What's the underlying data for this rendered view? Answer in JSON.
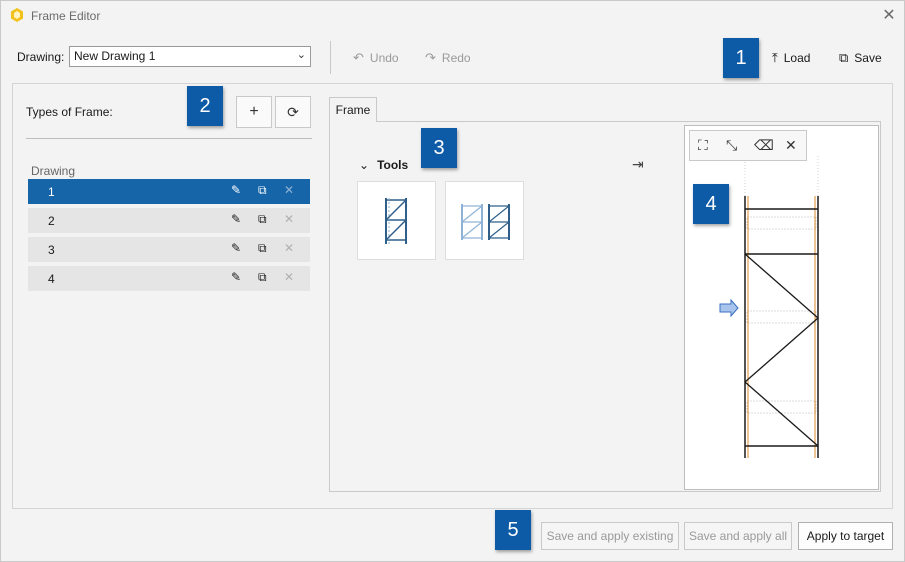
{
  "window": {
    "title": "Frame Editor",
    "close_icon": "close-icon"
  },
  "toolbar": {
    "drawing_label": "Drawing:",
    "drawing_value": "New Drawing 1",
    "undo_label": "Undo",
    "redo_label": "Redo",
    "load_label": "Load",
    "save_label": "Save"
  },
  "left": {
    "types_label": "Types of Frame:",
    "list_header": "Drawing",
    "items": [
      {
        "label": "1",
        "selected": true
      },
      {
        "label": "2",
        "selected": false
      },
      {
        "label": "3",
        "selected": false
      },
      {
        "label": "4",
        "selected": false
      }
    ]
  },
  "tabs": [
    {
      "label": "Frame"
    }
  ],
  "tools": {
    "header": "Tools"
  },
  "badges": [
    "1",
    "2",
    "3",
    "4",
    "5"
  ],
  "bottom": {
    "save_apply_existing": "Save and apply existing",
    "save_apply_all": "Save and apply all",
    "apply_to_target": "Apply to target"
  },
  "colors": {
    "accent": "#1565a8",
    "badge": "#0d5aa7",
    "app_icon": "#f2c21b"
  }
}
